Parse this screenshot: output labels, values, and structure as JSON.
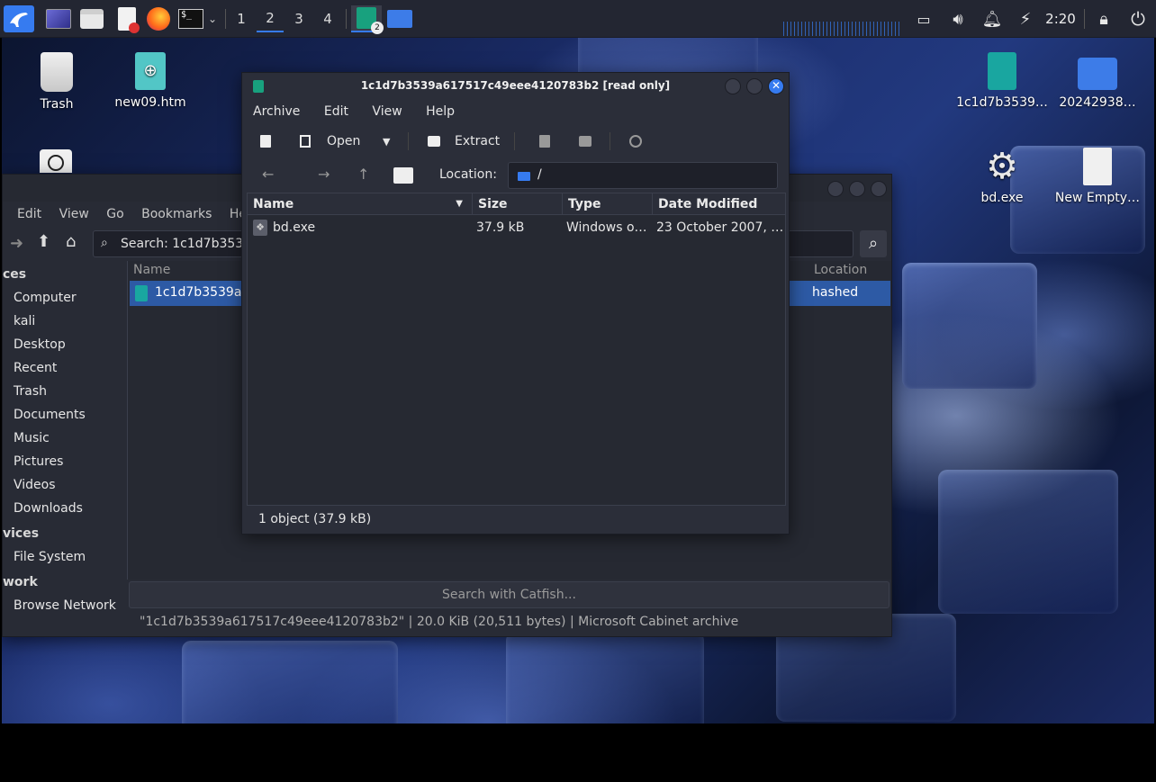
{
  "panel": {
    "workspaces": [
      "1",
      "2",
      "3",
      "4"
    ],
    "active_workspace": "2",
    "badge": "2",
    "clock": "2:20"
  },
  "desktop": {
    "icons": {
      "trash": "Trash",
      "new09": "new09.htm",
      "archive": "1c1d7b3539…",
      "folder": "20242938…",
      "bdexe": "bd.exe",
      "newempty": "New Empty…"
    }
  },
  "file_manager": {
    "menu": [
      "Edit",
      "View",
      "Go",
      "Bookmarks",
      "Help"
    ],
    "search_value": "Search: 1c1d7b3539a",
    "sidebar": {
      "places_header": "ces",
      "places": [
        "Computer",
        "kali",
        "Desktop",
        "Recent",
        "Trash",
        "Documents",
        "Music",
        "Pictures",
        "Videos",
        "Downloads"
      ],
      "devices_header": "vices",
      "devices": [
        "File System"
      ],
      "network_header": "work",
      "network": [
        "Browse Network"
      ]
    },
    "columns": {
      "name": "Name",
      "location": "Location"
    },
    "row": {
      "name": "1c1d7b3539a61",
      "location": "hashed"
    },
    "catfish": "Search with Catfish...",
    "status": "\"1c1d7b3539a617517c49eee4120783b2\" | 20.0 KiB (20,511 bytes) | Microsoft Cabinet archive"
  },
  "archive": {
    "title": "1c1d7b3539a617517c49eee4120783b2 [read only]",
    "menu": [
      "Archive",
      "Edit",
      "View",
      "Help"
    ],
    "toolbar": {
      "open": "Open",
      "extract": "Extract"
    },
    "location_label": "Location:",
    "location_value": "/",
    "columns": {
      "name": "Name",
      "size": "Size",
      "type": "Type",
      "date": "Date Modified"
    },
    "rows": [
      {
        "name": "bd.exe",
        "size": "37.9 kB",
        "type": "Windows or…",
        "date": "23 October 2007, 0…"
      }
    ],
    "status": "1 object (37.9 kB)"
  },
  "colors": {
    "accent": "#367bf0",
    "selection": "#2d5aa5",
    "window_bg": "#2b2e39",
    "panel_bg": "#232632"
  }
}
